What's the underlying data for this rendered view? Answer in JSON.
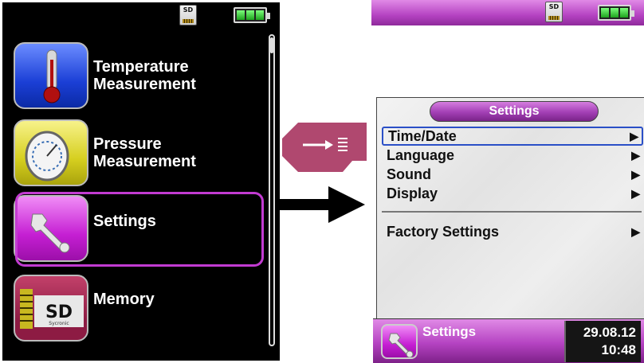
{
  "left_screen": {
    "status": {
      "sd_label": "SD",
      "battery_cells": 3
    },
    "menu": [
      {
        "label": "Temperature\nMeasurement",
        "icon": "thermometer-icon",
        "selected": false
      },
      {
        "label": "Pressure\nMeasurement",
        "icon": "pressure-gauge-icon",
        "selected": false
      },
      {
        "label": "Settings",
        "icon": "wrench-icon",
        "selected": true
      },
      {
        "label": "Memory",
        "icon": "sd-card-icon",
        "icon_text": "SD",
        "icon_subtext": "Sycronic",
        "selected": false
      }
    ]
  },
  "middle": {
    "key_icon": "menu-key-icon",
    "arrow_icon": "right-arrow-icon"
  },
  "right_screen": {
    "status": {
      "sd_label": "SD",
      "battery_cells": 3
    },
    "panel_title": "Settings",
    "rows": [
      {
        "label": "Time/Date",
        "arrow": "▶",
        "focused": true
      },
      {
        "label": "Language",
        "arrow": "▶",
        "focused": false
      },
      {
        "label": "Sound",
        "arrow": "▶",
        "focused": false
      },
      {
        "label": "Display",
        "arrow": "▶",
        "focused": false
      }
    ],
    "extra_row": {
      "label": "Factory Settings",
      "arrow": "▶"
    },
    "bottom_bar": {
      "label": "Settings",
      "date": "29.08.12",
      "time": "10:48",
      "icon": "wrench-icon"
    }
  },
  "colors": {
    "accent_purple": "#c23bd1",
    "focus_blue": "#2a4fc7",
    "battery_green": "#1da21d"
  }
}
